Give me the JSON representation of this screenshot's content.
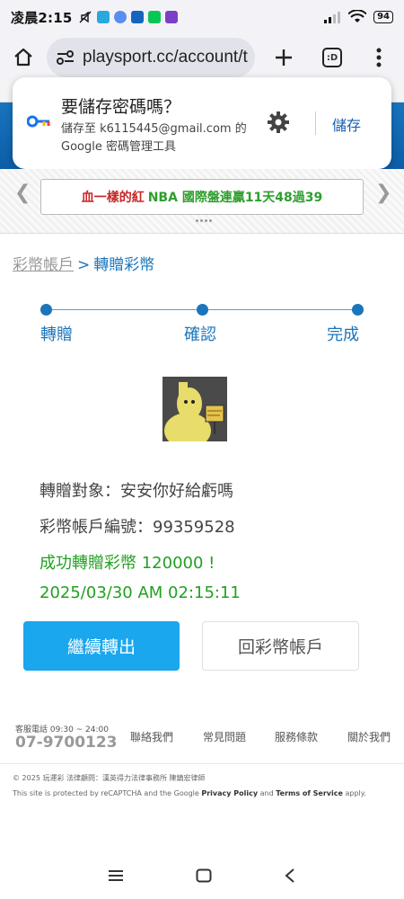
{
  "status_bar": {
    "time": "凌晨2:15",
    "battery": "94"
  },
  "browser": {
    "url": "playsport.cc/account/t",
    "tabs_label": ":D",
    "icons": [
      "home-icon",
      "site-info-icon",
      "plus-icon",
      "tabs-icon",
      "more-vert-icon"
    ]
  },
  "password_popup": {
    "title": "要儲存密碼嗎？",
    "subtitle": "儲存至 k6115445@gmail.com 的 Google 密碼管理工具",
    "save_label": "儲存",
    "icons": [
      "key-icon",
      "gear-icon"
    ]
  },
  "marquee": {
    "text_red": "血一樣的紅",
    "text_green": "NBA 國際盤連贏11天48過39"
  },
  "breadcrumb": {
    "parent": "彩幣帳戶",
    "separator": ">",
    "current": "轉贈彩幣"
  },
  "stepper": {
    "steps": [
      "轉贈",
      "確認",
      "完成"
    ]
  },
  "transfer": {
    "recipient": "轉贈對象：安安你好給虧嗎",
    "account_number": "彩幣帳戶編號：99359528",
    "success_message": "成功轉贈彩幣 120000 !",
    "timestamp": "2025/03/30 AM 02:15:11"
  },
  "actions": {
    "continue_label": "繼續轉出",
    "back_label": "回彩幣帳戶"
  },
  "footer": {
    "phone_label": "客服電話 09:30 ~ 24:00",
    "phone": "07-9700123",
    "links": [
      "聯絡我們",
      "常見問題",
      "服務條款",
      "關於我們"
    ],
    "copyright": "© 2025 玩運彩 法律顧問：漢英得力法律事務所 陳鎮宏律師",
    "recaptcha_prefix": "This site is protected by reCAPTCHA and the Google",
    "privacy_policy": "Privacy Policy",
    "and": "and",
    "terms": "Terms of Service",
    "apply": "apply."
  },
  "colors": {
    "accent": "#1a75bb",
    "button_blue": "#1aa7ee",
    "success_green": "#22a022"
  }
}
